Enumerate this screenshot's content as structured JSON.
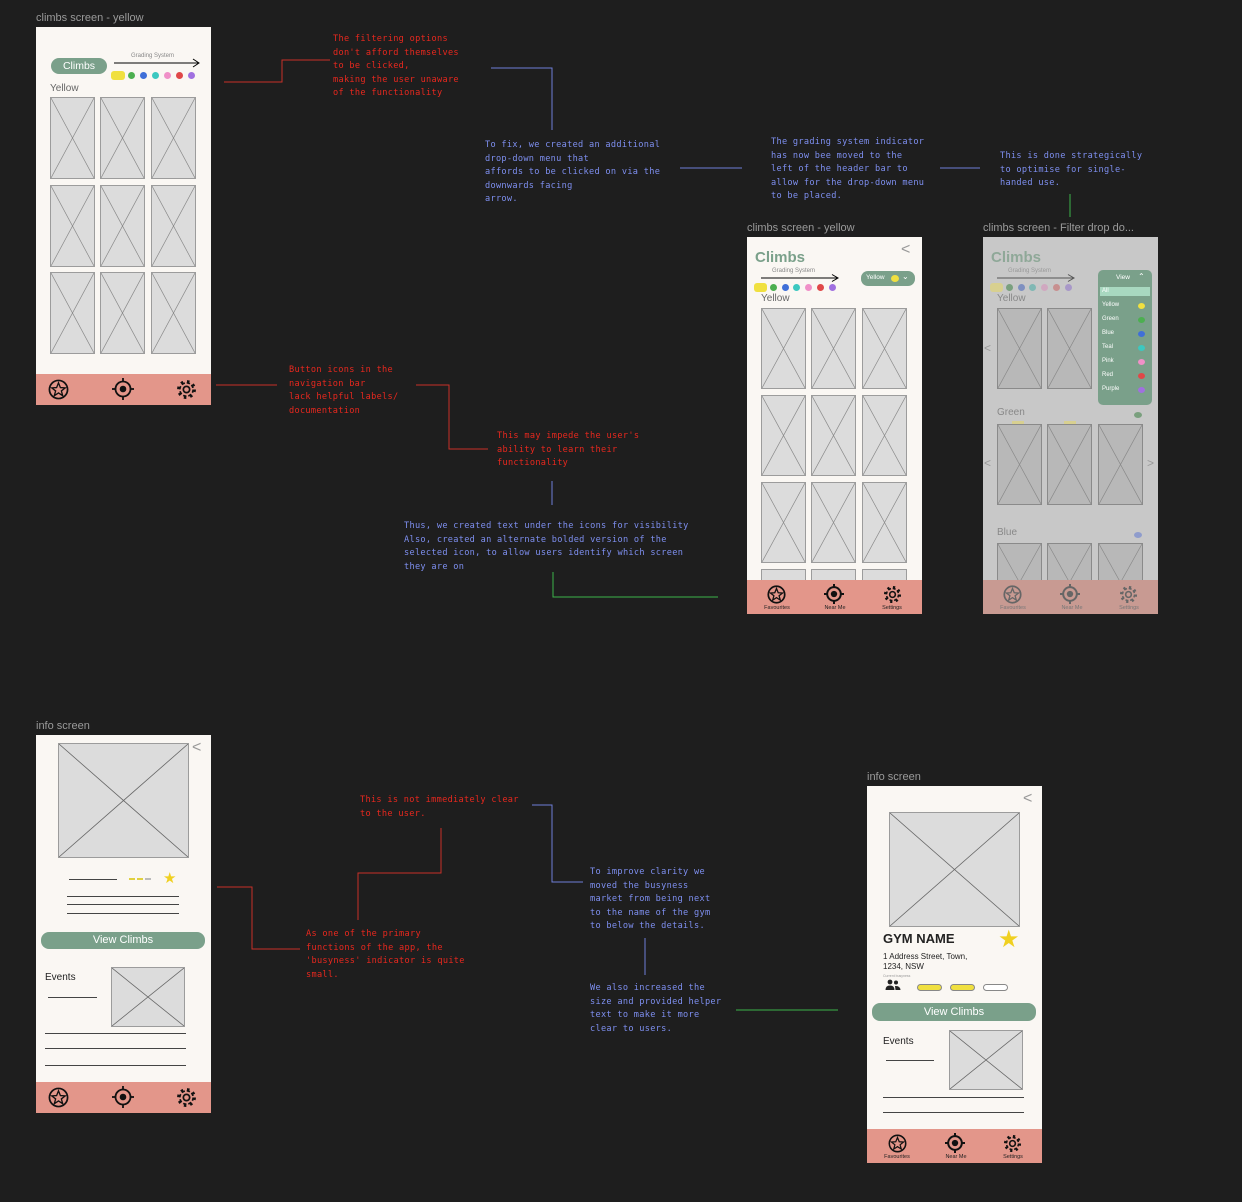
{
  "frames": {
    "a": {
      "label": "climbs screen - yellow",
      "pill": "Climbs",
      "grading": "Grading System",
      "section": "Yellow"
    },
    "b": {
      "label": "climbs screen - yellow",
      "title": "Climbs",
      "grading": "Grading System",
      "section": "Yellow",
      "dropdown": "Yellow"
    },
    "c": {
      "label": "climbs screen - Filter drop do...",
      "title": "Climbs",
      "grading": "Grading System",
      "section": "Yellow",
      "menu_header": "View",
      "menu_items": [
        "All",
        "Yellow",
        "Green",
        "Blue",
        "Teal",
        "Pink",
        "Red",
        "Purple"
      ],
      "section2": "Green",
      "section3": "Blue"
    },
    "d": {
      "label": "info screen",
      "view_button": "View Climbs",
      "events": "Events"
    },
    "e": {
      "label": "info screen",
      "gym_name": "GYM NAME",
      "address_line1": "1 Address Street, Town,",
      "address_line2": "1234, NSW",
      "helper": "Current busyness",
      "view_button": "View Climbs",
      "events": "Events"
    }
  },
  "nav": {
    "favourites": "Favourites",
    "near_me": "Near Me",
    "settings": "Settings"
  },
  "notes": {
    "n1": "The filtering options\ndon't afford themselves\nto be clicked,\nmaking the user unaware\nof the functionality",
    "n2": "To fix, we created an additional\ndrop-down menu that\naffords to be clicked on via the\ndownwards facing\narrow.",
    "n3": "The grading system indicator\nhas now bee moved to the\nleft of the header bar to\nallow for the drop-down menu\nto be placed.",
    "n4": "This is done strategically\nto optimise for single-\nhanded use.",
    "n5": "Button icons in the\nnavigation bar\nlack helpful labels/\ndocumentation",
    "n6": "This may impede the user's\nability to learn their\nfunctionality",
    "n7": "Thus, we created text under the icons for visibility\nAlso, created an alternate bolded version of the\nselected icon, to allow users identify which screen\nthey are on",
    "n8": "This is not immediately clear\nto the user.",
    "n9": "As one of the primary\nfunctions of the app, the\n'busyness' indicator is quite\nsmall.",
    "n10": "To improve clarity we\nmoved the busyness\nmarket from being next\nto the name of the gym\nto below the details.",
    "n11": "We also increased the\nsize and provided helper\ntext to make it more\nclear to users."
  },
  "colors": {
    "bg": "#1e1e1e",
    "frame": "#faf7f3",
    "nav": "#e3968a",
    "accent": "#7aa08a",
    "red_note": "#e8281e",
    "blue_note": "#7e8ff0",
    "green_line": "#3cb44b",
    "grades": [
      "#f0e040",
      "#4caf50",
      "#3f6fd8",
      "#3cc8c0",
      "#f090c8",
      "#e04848",
      "#a070e0"
    ]
  },
  "icons": [
    "star-icon",
    "target-icon",
    "gear-icon",
    "chevron-left-icon",
    "chevron-down-icon",
    "people-icon"
  ]
}
